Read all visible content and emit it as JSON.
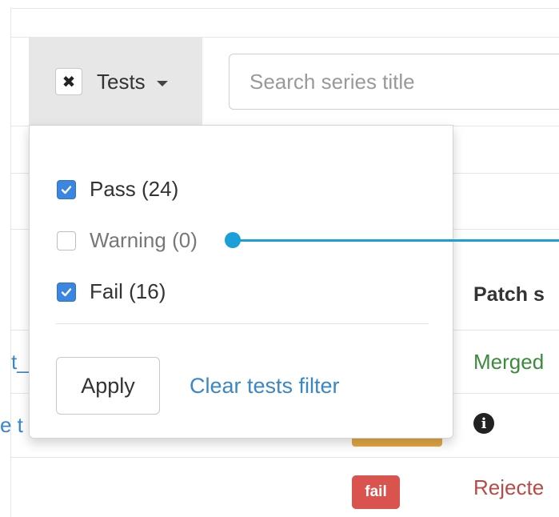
{
  "toolbar": {
    "tests_filter_label": "Tests",
    "clear_icon_glyph": "✖",
    "search_placeholder": "Search series title"
  },
  "dropdown": {
    "options": [
      {
        "label": "Pass (24)",
        "checked": true
      },
      {
        "label": "Warning (0)",
        "checked": false
      },
      {
        "label": "Fail (16)",
        "checked": true
      }
    ],
    "apply_label": "Apply",
    "clear_label": "Clear tests filter"
  },
  "table": {
    "column_header": "Patch s",
    "rows": [
      {
        "link_fragment": "t_",
        "status": "Merged"
      },
      {
        "link_fragment": "e t",
        "status_icon": "info-icon"
      },
      {
        "badge": "fail",
        "status": "Rejecte"
      }
    ],
    "info_glyph": "i"
  },
  "colors": {
    "accent": "#3a86e0",
    "link": "#3a87c8",
    "merged": "#3c8b3c",
    "rejected": "#b94a48",
    "fail_badge": "#d9534f",
    "warning_badge": "#e3a742",
    "callout": "#1a9fd8"
  }
}
